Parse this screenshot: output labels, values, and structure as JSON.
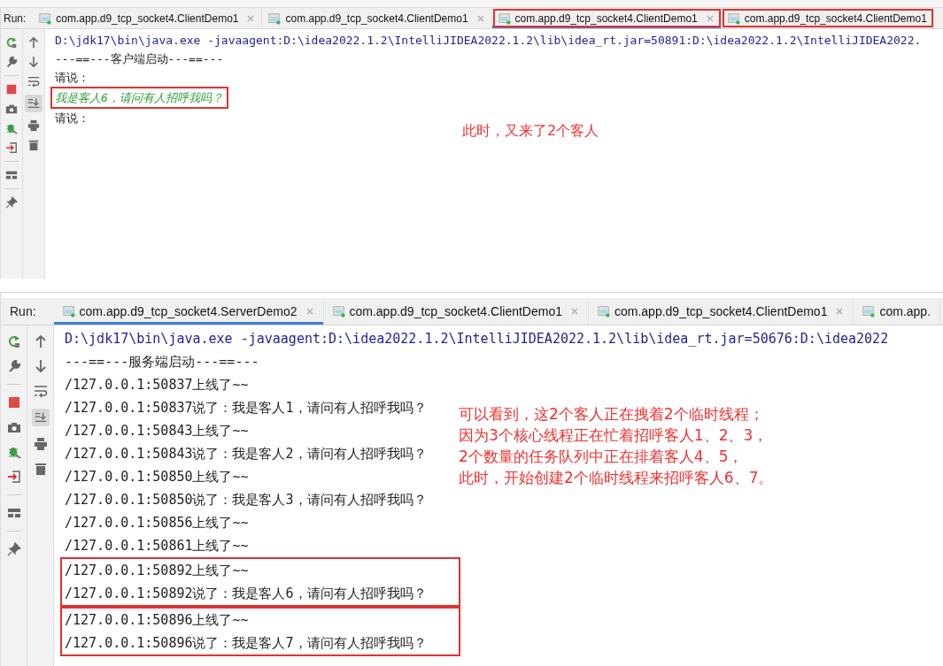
{
  "top_panel": {
    "run_label": "Run:",
    "toolbar": {
      "scroll_to_end": true
    },
    "tabs": [
      {
        "label": "com.app.d9_tcp_socket4.ClientDemo1",
        "selected": false,
        "boxed": false,
        "closable": true
      },
      {
        "label": "com.app.d9_tcp_socket4.ClientDemo1",
        "selected": false,
        "boxed": false,
        "closable": true
      },
      {
        "label": "com.app.d9_tcp_socket4.ClientDemo1",
        "selected": true,
        "boxed": true,
        "closable": true
      },
      {
        "label": "com.app.d9_tcp_socket4.ClientDemo1",
        "selected": false,
        "boxed": true,
        "closable": false
      }
    ],
    "blocks": [
      {
        "boxed": false,
        "lines": [
          {
            "kind": "command",
            "text": "D:\\jdk17\\bin\\java.exe -javaagent:D:\\idea2022.1.2\\IntelliJIDEA2022.1.2\\lib\\idea_rt.jar=50891:D:\\idea2022.1.2\\IntelliJIDEA2022."
          },
          {
            "kind": "plain",
            "text": "---==---客户端启动---==---"
          },
          {
            "kind": "plain",
            "text": "请说："
          }
        ]
      },
      {
        "boxed": true,
        "lines": [
          {
            "kind": "input",
            "text": "我是客人6，请问有人招呼我吗？"
          }
        ]
      },
      {
        "boxed": false,
        "lines": [
          {
            "kind": "plain",
            "text": "请说："
          }
        ]
      }
    ],
    "note": [
      "此时，又来了2个客人"
    ]
  },
  "bottom_panel": {
    "run_label": "Run:",
    "toolbar": {
      "scroll_to_end": true
    },
    "tabs": [
      {
        "label": "com.app.d9_tcp_socket4.ServerDemo2",
        "selected": true,
        "boxed": false,
        "closable": true
      },
      {
        "label": "com.app.d9_tcp_socket4.ClientDemo1",
        "selected": false,
        "boxed": false,
        "closable": true
      },
      {
        "label": "com.app.d9_tcp_socket4.ClientDemo1",
        "selected": false,
        "boxed": false,
        "closable": true
      },
      {
        "label": "com.app.",
        "selected": false,
        "boxed": false,
        "closable": false
      }
    ],
    "blocks": [
      {
        "boxed": false,
        "lines": [
          {
            "kind": "command",
            "text": "D:\\jdk17\\bin\\java.exe -javaagent:D:\\idea2022.1.2\\IntelliJIDEA2022.1.2\\lib\\idea_rt.jar=50676:D:\\idea2022"
          },
          {
            "kind": "plain",
            "text": "---==---服务端启动---==---"
          },
          {
            "kind": "plain",
            "text": "/127.0.0.1:50837上线了~~"
          },
          {
            "kind": "plain",
            "text": "/127.0.0.1:50837说了：我是客人1，请问有人招呼我吗？"
          },
          {
            "kind": "plain",
            "text": "/127.0.0.1:50843上线了~~"
          },
          {
            "kind": "plain",
            "text": "/127.0.0.1:50843说了：我是客人2，请问有人招呼我吗？"
          },
          {
            "kind": "plain",
            "text": "/127.0.0.1:50850上线了~~"
          },
          {
            "kind": "plain",
            "text": "/127.0.0.1:50850说了：我是客人3，请问有人招呼我吗？"
          },
          {
            "kind": "plain",
            "text": "/127.0.0.1:50856上线了~~"
          },
          {
            "kind": "plain",
            "text": "/127.0.0.1:50861上线了~~"
          }
        ]
      },
      {
        "boxed": true,
        "lines": [
          {
            "kind": "plain",
            "text": "/127.0.0.1:50892上线了~~"
          },
          {
            "kind": "plain",
            "text": "/127.0.0.1:50892说了：我是客人6，请问有人招呼我吗？"
          }
        ]
      },
      {
        "boxed": true,
        "lines": [
          {
            "kind": "plain",
            "text": "/127.0.0.1:50896上线了~~"
          },
          {
            "kind": "plain",
            "text": "/127.0.0.1:50896说了：我是客人7，请问有人招呼我吗？"
          }
        ]
      }
    ],
    "note": [
      "可以看到，这2个客人正在拽着2个临时线程；",
      "因为3个核心线程正在忙着招呼客人1、2、3，",
      "2个数量的任务队列中正在排着客人4、5，",
      "此时，开始创建2个临时线程来招呼客人6、7。"
    ]
  }
}
